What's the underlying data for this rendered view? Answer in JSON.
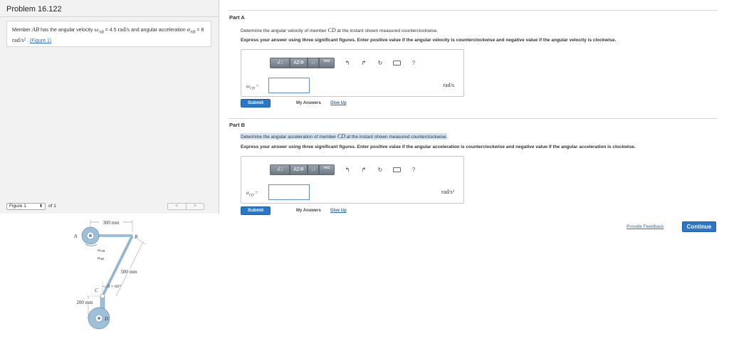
{
  "problem": {
    "title": "Problem 16.122",
    "statement": {
      "s1": "Member ",
      "member": "AB",
      "s2": " has the angular velocity ",
      "omega_sym": "ω",
      "omega_sub": "AB",
      "s3": " = 4.5 ",
      "omega_unit": "rad/s",
      "s4": " and angular acceleration ",
      "alpha_sym": "α",
      "alpha_sub": "AB",
      "s5": " = 8 ",
      "alpha_unit": "rad/s²",
      "s6": " . ",
      "figure_link": "(Figure 1)"
    }
  },
  "figure_nav": {
    "selected": "Figure 1",
    "of_label": "of 1",
    "prev": "<",
    "next": ">",
    "labels": {
      "dim_top": "300 mm",
      "dim_side": "500 mm",
      "dim_left": "200 mm",
      "A": "A",
      "B": "B",
      "C": "C",
      "D": "D",
      "omega": "ω",
      "alpha": "α",
      "ab": "AB",
      "theta": "θ = 60°"
    }
  },
  "toolbar": {
    "templates": "√□",
    "greek": "ΑΣΦ",
    "arrows": "↓↑",
    "vec": "vec",
    "undo_icon": "undo-icon",
    "redo_icon": "redo-icon",
    "reset_icon": "reset-icon",
    "keyboard_icon": "keyboard-icon",
    "help": "?"
  },
  "part_a": {
    "title": "Part A",
    "q1": "Determine the angular velocity of member ",
    "q_var": "CD",
    "q2": " at the instant shown measured counterclockwise.",
    "instructions": "Express your answer using three significant figures. Enter positive value if the angular velocity is counterclockwise and negative value if the angular velocity is clockwise.",
    "label_sym": "ω",
    "label_sub": "CD",
    "label_eq": " =",
    "input_value": "",
    "unit": "rad/s",
    "submit": "Submit",
    "my_answers": "My Answers",
    "give_up": "Give Up"
  },
  "part_b": {
    "title": "Part B",
    "q1": "Determine the angular acceleration of member ",
    "q_var": "CD",
    "q2": " at the instant shown measured counterclockwise.",
    "instructions": "Express your answer using three significant figures. Enter positive value if the angular acceleration is counterclockwise and negative value if the angular acceleration is clockwise.",
    "label_sym": "α",
    "label_sub": "CD",
    "label_eq": " =",
    "input_value": "",
    "unit": "rad/s²",
    "submit": "Submit",
    "my_answers": "My Answers",
    "give_up": "Give Up"
  },
  "footer": {
    "feedback": "Provide Feedback",
    "continue": "Continue"
  },
  "colors": {
    "accent": "#2a77c9",
    "link": "#2a6db0",
    "highlight": "#d0e3f5",
    "member": "#9dbfd8"
  }
}
